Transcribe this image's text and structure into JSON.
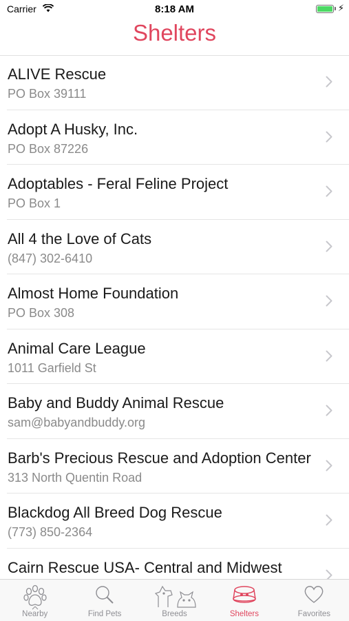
{
  "status": {
    "carrier": "Carrier",
    "time": "8:18 AM"
  },
  "nav": {
    "title": "Shelters"
  },
  "shelters": [
    {
      "name": "ALIVE Rescue",
      "detail": "PO Box 39111"
    },
    {
      "name": "Adopt A Husky, Inc.",
      "detail": "PO Box 87226"
    },
    {
      "name": "Adoptables - Feral Feline Project",
      "detail": "PO Box 1"
    },
    {
      "name": "All 4 the Love of Cats",
      "detail": "(847) 302-6410"
    },
    {
      "name": "Almost Home Foundation",
      "detail": "PO Box 308"
    },
    {
      "name": "Animal Care League",
      "detail": "1011 Garfield St"
    },
    {
      "name": "Baby and Buddy Animal Rescue",
      "detail": "sam@babyandbuddy.org"
    },
    {
      "name": "Barb's Precious Rescue and Adoption Center",
      "detail": "313 North Quentin Road"
    },
    {
      "name": "Blackdog All Breed Dog Rescue",
      "detail": "(773) 850-2364"
    },
    {
      "name": "Cairn Rescue USA- Central and Midwest",
      "detail": ""
    }
  ],
  "tabs": [
    {
      "label": "Nearby",
      "icon": "paw-icon"
    },
    {
      "label": "Find Pets",
      "icon": "magnifier-icon"
    },
    {
      "label": "Breeds",
      "icon": "dog-cat-icon"
    },
    {
      "label": "Shelters",
      "icon": "pet-bowl-icon"
    },
    {
      "label": "Favorites",
      "icon": "heart-icon"
    }
  ],
  "colors": {
    "accent": "#e0465e",
    "battery": "#4cd964",
    "tab_inactive": "#8e8e93"
  }
}
